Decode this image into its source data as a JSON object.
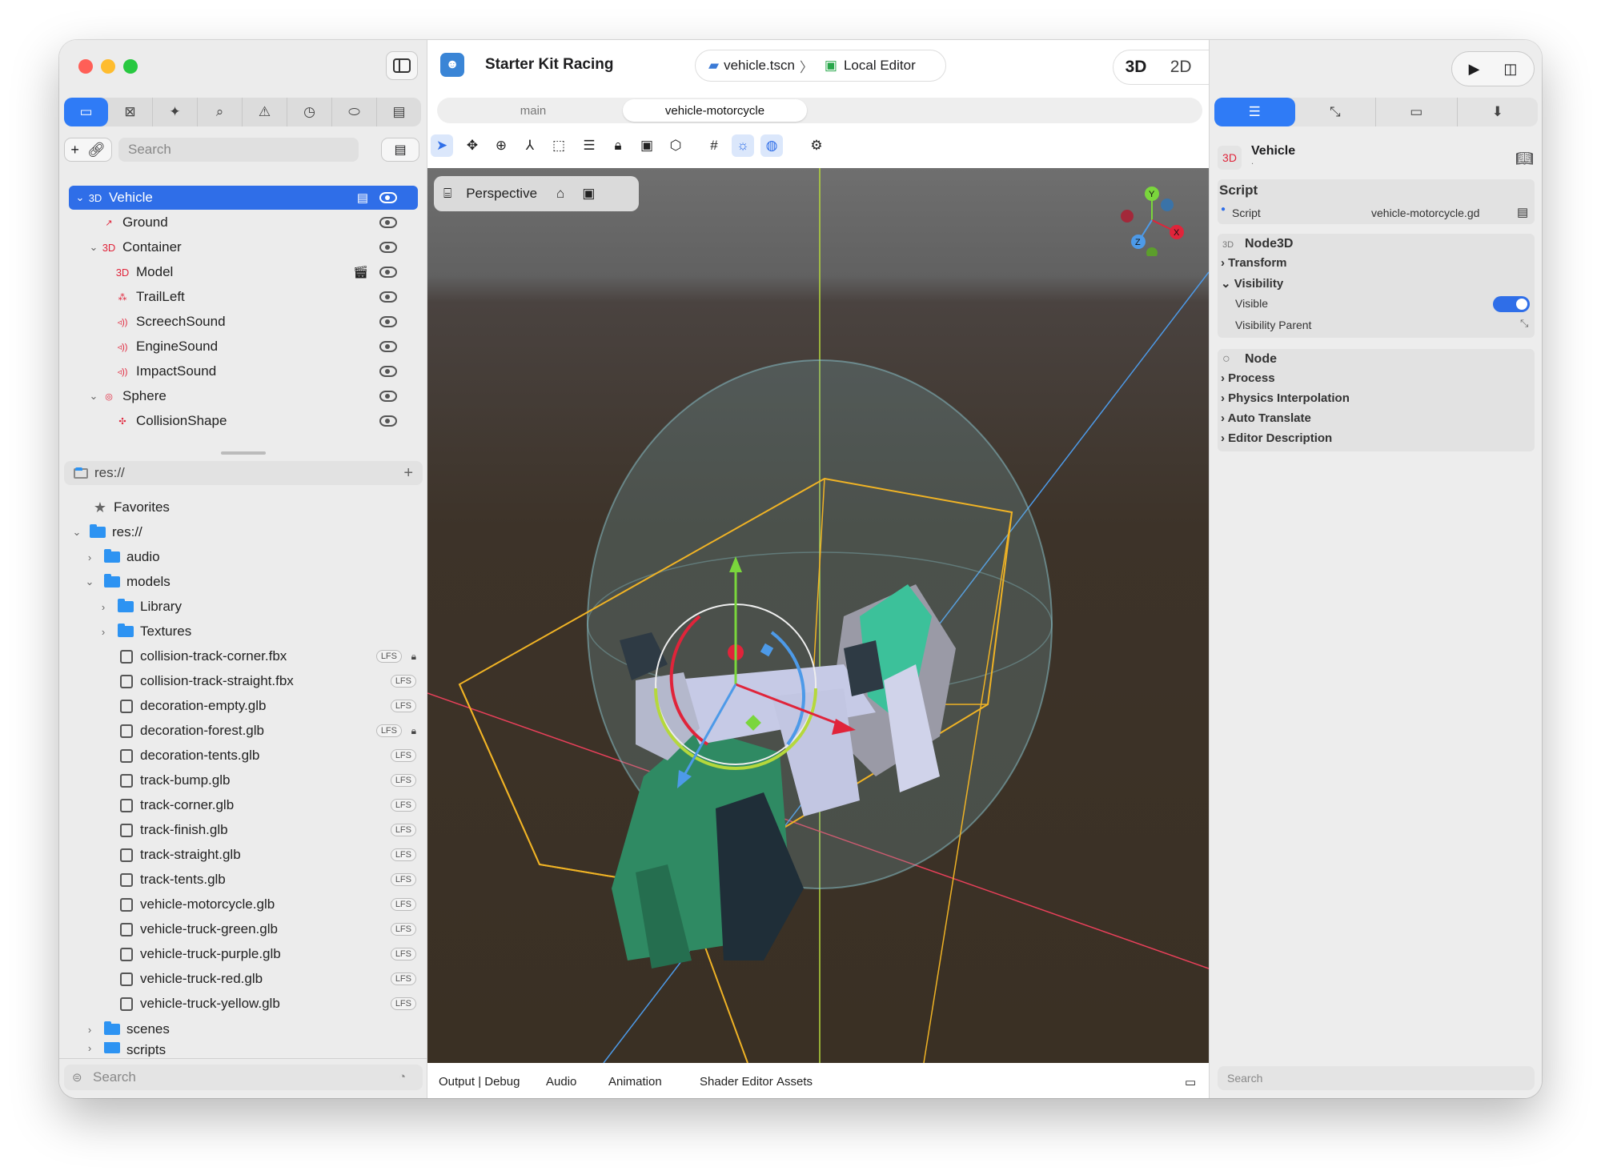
{
  "app": {
    "title": "Starter Kit Racing"
  },
  "breadcrumb": {
    "file": "vehicle.tscn",
    "separator": "〉",
    "location": "Local Editor"
  },
  "modes": {
    "mode_3d": "3D",
    "mode_2d": "2D"
  },
  "scene_tabs": [
    "main",
    "vehicle-motorcycle"
  ],
  "left": {
    "search_placeholder": "Search",
    "scene_tree": [
      {
        "label": "Vehicle",
        "badge": "3D",
        "depth": 0,
        "chevron": "⌄",
        "selected": true
      },
      {
        "label": "Ground",
        "badge": "↗",
        "depth": 1
      },
      {
        "label": "Container",
        "badge": "3D",
        "depth": 1,
        "chevron": "⌄"
      },
      {
        "label": "Model",
        "badge": "3D",
        "depth": 2
      },
      {
        "label": "TrailLeft",
        "badge": "⁂",
        "depth": 2
      },
      {
        "label": "ScreechSound",
        "badge": "◃))",
        "depth": 2
      },
      {
        "label": "EngineSound",
        "badge": "◃))",
        "depth": 2
      },
      {
        "label": "ImpactSound",
        "badge": "◃))",
        "depth": 2
      },
      {
        "label": "Sphere",
        "badge": "◎",
        "depth": 1,
        "chevron": "⌄"
      },
      {
        "label": "CollisionShape",
        "badge": "✣",
        "depth": 2
      }
    ],
    "filesystem_path": "res://",
    "filesystem_add": "+",
    "favorites": "Favorites",
    "root": "res://",
    "folders": {
      "audio": "audio",
      "models": "models",
      "library": "Library",
      "textures": "Textures",
      "scenes": "scenes",
      "scripts": "scripts"
    },
    "files": [
      {
        "name": "collision-track-corner.fbx",
        "tag": "LFS",
        "locked": true
      },
      {
        "name": "collision-track-straight.fbx",
        "tag": "LFS"
      },
      {
        "name": "decoration-empty.glb",
        "tag": "LFS"
      },
      {
        "name": "decoration-forest.glb",
        "tag": "LFS",
        "locked": true
      },
      {
        "name": "decoration-tents.glb",
        "tag": "LFS"
      },
      {
        "name": "track-bump.glb",
        "tag": "LFS"
      },
      {
        "name": "track-corner.glb",
        "tag": "LFS"
      },
      {
        "name": "track-finish.glb",
        "tag": "LFS"
      },
      {
        "name": "track-straight.glb",
        "tag": "LFS"
      },
      {
        "name": "track-tents.glb",
        "tag": "LFS"
      },
      {
        "name": "vehicle-motorcycle.glb",
        "tag": "LFS"
      },
      {
        "name": "vehicle-truck-green.glb",
        "tag": "LFS"
      },
      {
        "name": "vehicle-truck-purple.glb",
        "tag": "LFS"
      },
      {
        "name": "vehicle-truck-red.glb",
        "tag": "LFS"
      },
      {
        "name": "vehicle-truck-yellow.glb",
        "tag": "LFS"
      }
    ],
    "bottom_search": "Search"
  },
  "viewport": {
    "perspective_label": "Perspective",
    "gizmo": {
      "x": "X",
      "y": "Y",
      "z": "Z"
    }
  },
  "bottom_tabs": [
    "Output | Debug",
    "Audio",
    "Animation",
    "Shader Editor",
    "Assets"
  ],
  "inspector": {
    "node_badge": "3D",
    "node_name": "Vehicle",
    "node_sub": ".",
    "script_header": "Script",
    "script_label": "Script",
    "script_value": "vehicle-motorcycle.gd",
    "node3d_badge": "3D",
    "node3d_header": "Node3D",
    "transform": "Transform",
    "visibility": "Visibility",
    "visible_label": "Visible",
    "visibility_parent": "Visibility Parent",
    "node_header": "Node",
    "process": "Process",
    "physics_interp": "Physics  Interpolation",
    "auto_translate": "Auto  Translate",
    "editor_desc": "Editor  Description",
    "search_placeholder": "Search"
  },
  "colors": {
    "accent": "#2f6ee8",
    "node_red": "#e0243a",
    "folder": "#2d93f2"
  }
}
